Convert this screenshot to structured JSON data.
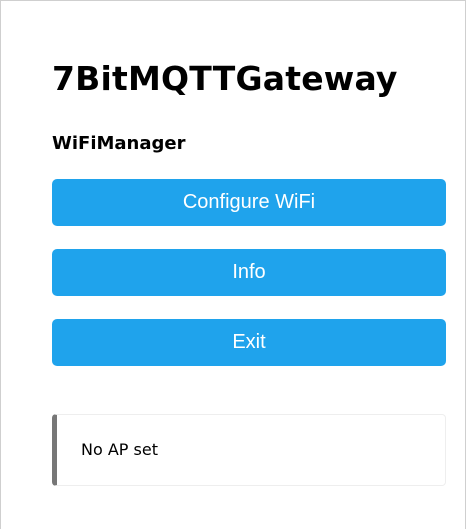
{
  "header": {
    "title": "7BitMQTTGateway",
    "subtitle": "WiFiManager"
  },
  "menu": {
    "configure_label": "Configure WiFi",
    "info_label": "Info",
    "exit_label": "Exit"
  },
  "status": {
    "message": "No AP set"
  },
  "colors": {
    "button_bg": "#1fa3ec",
    "button_text": "#ffffff",
    "message_border": "#777777"
  }
}
